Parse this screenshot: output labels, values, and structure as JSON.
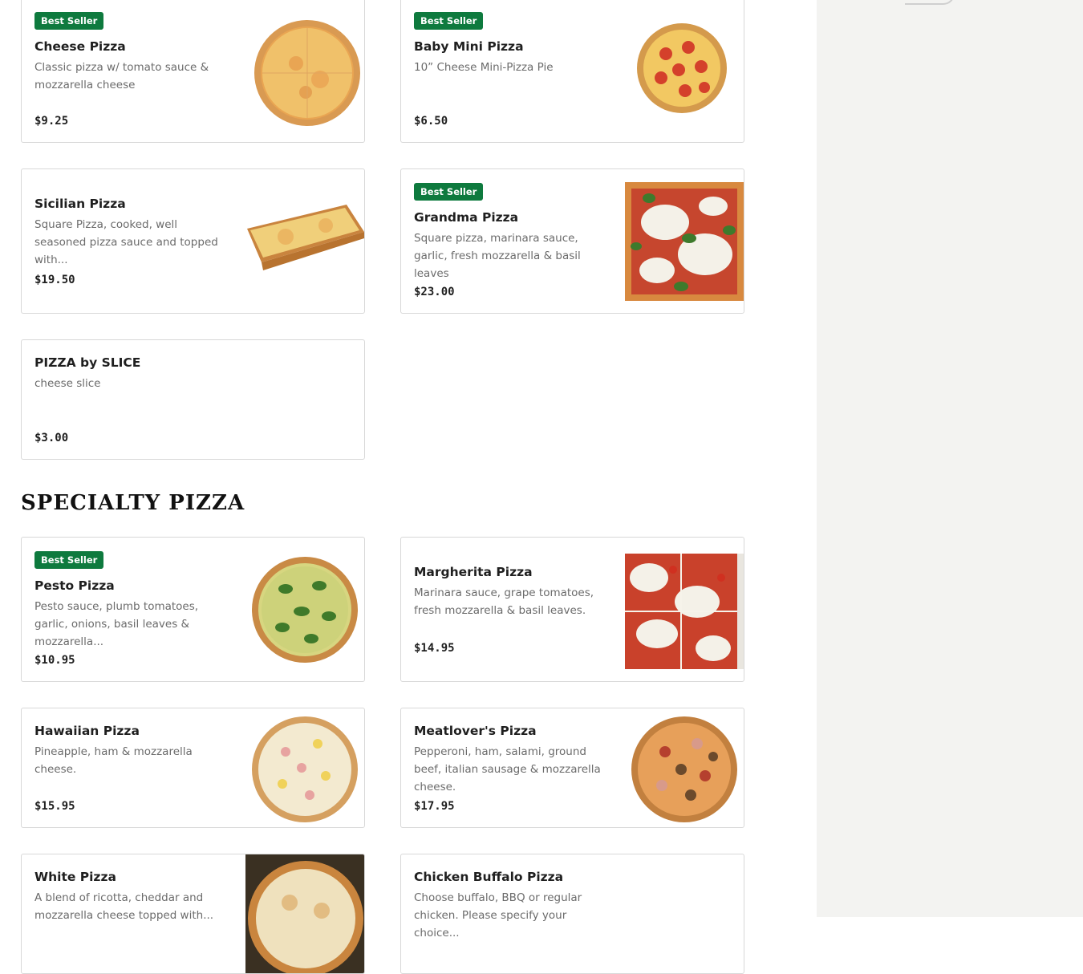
{
  "menu": {
    "cards": [
      {
        "badge": "Best Seller",
        "name": "Cheese Pizza",
        "desc": "Classic pizza w/ tomato sauce & mozzarella cheese",
        "price": "$9.25"
      },
      {
        "badge": "Best Seller",
        "name": "Baby Mini Pizza",
        "desc": "10” Cheese Mini-Pizza Pie",
        "price": "$6.50"
      },
      {
        "name": "Sicilian Pizza",
        "desc": "Square Pizza, cooked, well seasoned pizza sauce and topped with...",
        "price": "$19.50"
      },
      {
        "badge": "Best Seller",
        "name": "Grandma Pizza",
        "desc": "Square pizza, marinara sauce, garlic, fresh mozzarella & basil leaves",
        "price": "$23.00"
      },
      {
        "name": "PIZZA by SLICE",
        "desc": "cheese slice",
        "price": "$3.00"
      }
    ]
  },
  "specialty": {
    "title": "SPECIALTY PIZZA",
    "cards": [
      {
        "badge": "Best Seller",
        "name": "Pesto Pizza",
        "desc": "Pesto sauce, plumb tomatoes, garlic, onions, basil leaves & mozzarella...",
        "price": "$10.95"
      },
      {
        "name": "Margherita Pizza",
        "desc": "Marinara sauce, grape tomatoes, fresh mozzarella & basil leaves.",
        "price": "$14.95"
      },
      {
        "name": "Hawaiian Pizza",
        "desc": "Pineapple, ham & mozzarella cheese.",
        "price": "$15.95"
      },
      {
        "name": "Meatlover's Pizza",
        "desc": "Pepperoni, ham, salami, ground beef, italian sausage & mozzarella cheese.",
        "price": "$17.95"
      },
      {
        "name": "White Pizza",
        "desc": "A blend of ricotta, cheddar and mozzarella cheese topped with...",
        "price": ""
      },
      {
        "name": "Chicken Buffalo Pizza",
        "desc": "Choose buffalo, BBQ or regular chicken. Please specify your choice...",
        "price": ""
      }
    ]
  },
  "colors": {
    "badge": "#0e7a3e",
    "border": "#d8d8d8",
    "map_panel": "#f3f3f1"
  }
}
